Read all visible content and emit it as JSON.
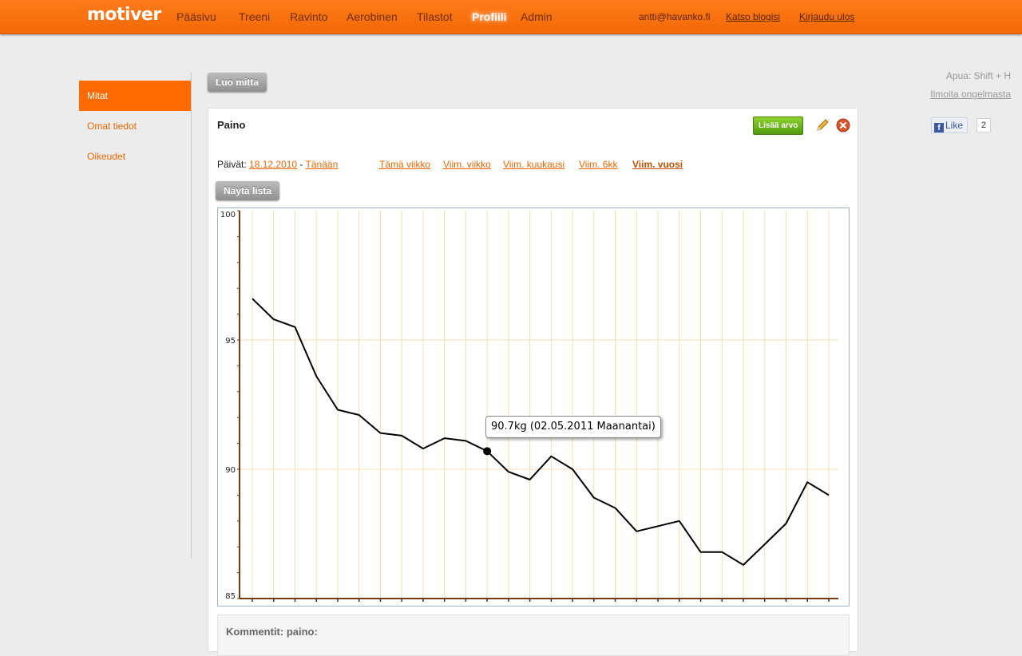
{
  "header": {
    "logo": "motiver",
    "nav": [
      "Pääsivu",
      "Treeni",
      "Ravinto",
      "Aerobinen",
      "Tilastot",
      "Profiili",
      "Admin"
    ],
    "active_nav": "Profiili",
    "user_email": "antti@havanko.fi",
    "blog_link": "Katso blogisi",
    "logout_link": "Kirjaudu ulos"
  },
  "sidebar": {
    "items": [
      {
        "label": "Mitat",
        "active": true
      },
      {
        "label": "Omat tiedot",
        "active": false
      },
      {
        "label": "Oikeudet",
        "active": false
      }
    ]
  },
  "create_button": "Luo mitta",
  "panel": {
    "title": "Paino",
    "add_value_button": "Lisää arvo",
    "dates_label": "Päivät:",
    "date_from": "18.12.2010",
    "date_sep": " - ",
    "date_to": "Tänään",
    "ranges": [
      "Tämä viikko",
      "Viim. viikko",
      "Viim. kuukausi",
      "Viim. 6kk",
      "Viim. vuosi"
    ],
    "active_range": "Viim. vuosi",
    "show_list_button": "Näytä lista",
    "comments_label": "Kommentit: paino:"
  },
  "right": {
    "help_hint": "Apua: Shift + H",
    "report_link": "Ilmoita ongelmasta",
    "fb_like": "Like",
    "fb_count": "2"
  },
  "tooltip": "90.7kg (02.05.2011 Maanantai)",
  "chart_data": {
    "type": "line",
    "series": [
      {
        "values": [
          96.6,
          95.8,
          95.5,
          93.6,
          92.3,
          92.1,
          91.4,
          91.3,
          90.8,
          91.2,
          91.1,
          90.7,
          89.9,
          89.6,
          90.5,
          90.0,
          88.9,
          88.5,
          87.6,
          87.8,
          88.0,
          86.8,
          86.8,
          86.3,
          87.1,
          87.9,
          89.5,
          89.0
        ]
      }
    ],
    "highlight_index": 11,
    "ylim": [
      85,
      100
    ],
    "yticks": [
      85,
      90,
      95,
      100
    ],
    "xtick_count": 28,
    "grid": true
  },
  "colors": {
    "accent": "#ff6a00",
    "grid": "#f3deb0",
    "axis": "#7a3a10"
  }
}
